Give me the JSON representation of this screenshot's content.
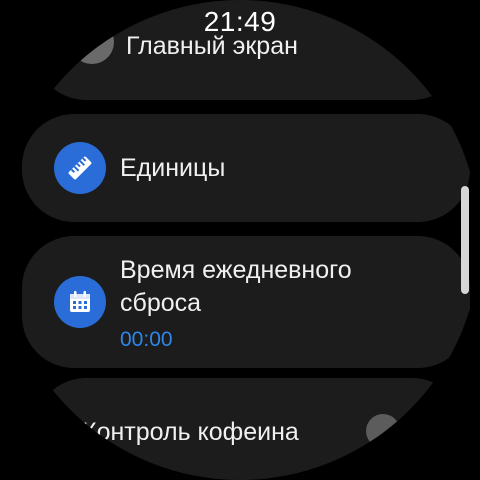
{
  "status": {
    "time": "21:49"
  },
  "settings": [
    {
      "label": "Главный экран",
      "icon": "home-screen-icon"
    },
    {
      "label": "Единицы",
      "icon": "ruler-icon"
    },
    {
      "label": "Время ежедневного сброса",
      "value": "00:00",
      "icon": "calendar-icon"
    },
    {
      "label": "Контроль кофеина",
      "icon": "toggle-switch"
    }
  ],
  "colors": {
    "accent": "#2a6dd8",
    "value_text": "#2d86e8",
    "card_bg": "#1c1c1c",
    "background": "#000000"
  }
}
